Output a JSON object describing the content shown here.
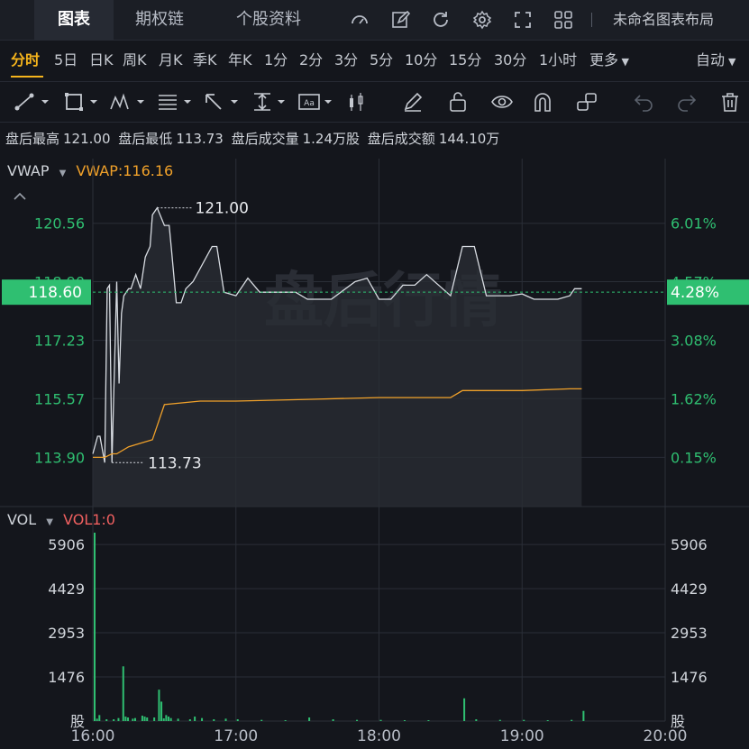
{
  "tabs": [
    {
      "label": "图表",
      "active": true
    },
    {
      "label": "期权链",
      "active": false
    },
    {
      "label": "个股资料",
      "active": false
    }
  ],
  "layout_label": "未命名图表布局",
  "toolbar_icons": [
    "gauge-icon",
    "edit-icon",
    "refresh-icon",
    "settings-icon",
    "fullscreen-icon",
    "grid-icon"
  ],
  "periods": [
    "分时",
    "5日",
    "日K",
    "周K",
    "月K",
    "季K",
    "年K",
    "1分",
    "2分",
    "3分",
    "5分",
    "10分",
    "15分",
    "30分",
    "1小时",
    "更多"
  ],
  "active_period": "分时",
  "auto_label": "自动",
  "drawing_tools": [
    "line-tool-icon",
    "rectangle-tool-icon",
    "pattern-tool-icon",
    "fib-tool-icon",
    "arrow-tool-icon",
    "measure-tool-icon",
    "text-tool-icon",
    "candle-tool-icon",
    "pen-icon",
    "unlock-icon",
    "eye-icon",
    "magnet-icon",
    "link-icon",
    "undo-icon",
    "redo-icon",
    "trash-icon"
  ],
  "info": {
    "high_label": "盘后最高",
    "high": "121.00",
    "low_label": "盘后最低",
    "low": "113.73",
    "vol_label": "盘后成交量",
    "vol": "1.24万股",
    "amt_label": "盘后成交额",
    "amt": "144.10万"
  },
  "main_indicator": {
    "name": "VWAP",
    "value_label": "VWAP:116.16"
  },
  "vol_indicator": {
    "name": "VOL",
    "value_label": "VOL1:0"
  },
  "watermark": "盘后行情",
  "current_price": "118.60",
  "current_pct": "4.28%",
  "high_marker": "121.00",
  "low_marker": "113.73",
  "colors": {
    "up": "#2fbf71",
    "down": "#f06060",
    "vwap": "#f0a12a",
    "accent": "#f5b41c",
    "bg": "#14161c"
  },
  "chart_data": [
    {
      "type": "line",
      "title": "",
      "x_ticks": [
        "16:00",
        "17:00",
        "18:00",
        "19:00",
        "20:00"
      ],
      "xlim": [
        "16:00",
        "20:00"
      ],
      "y_ticks": [
        "120.56",
        "118.90",
        "117.23",
        "115.57",
        "113.90"
      ],
      "y_ticks_right": [
        "6.01%",
        "4.57%",
        "3.08%",
        "1.62%",
        "0.15%"
      ],
      "ylim": [
        112.5,
        122.4
      ],
      "grid": true,
      "series": [
        {
          "name": "",
          "color": "#d8dce2",
          "x": [
            "16:00",
            "16:02",
            "16:03",
            "16:05",
            "16:06",
            "16:07",
            "16:08",
            "16:10",
            "16:11",
            "16:12",
            "16:13",
            "16:15",
            "16:16",
            "16:18",
            "16:20",
            "16:22",
            "16:24",
            "16:25",
            "16:27",
            "16:30",
            "16:32",
            "16:33",
            "16:35",
            "16:37",
            "16:39",
            "16:42",
            "16:50",
            "16:52",
            "16:55",
            "17:00",
            "17:05",
            "17:10",
            "17:12",
            "17:15",
            "17:20",
            "17:25",
            "17:30",
            "17:40",
            "17:50",
            "17:55",
            "18:00",
            "18:05",
            "18:10",
            "18:15",
            "18:20",
            "18:30",
            "18:35",
            "18:40",
            "18:45",
            "18:50",
            "18:55",
            "19:00",
            "19:05",
            "19:10",
            "19:15",
            "19:20",
            "19:22",
            "19:25"
          ],
          "values": [
            114.0,
            114.5,
            114.5,
            113.75,
            118.7,
            118.8,
            113.75,
            118.9,
            116.0,
            118.0,
            118.5,
            118.7,
            118.7,
            119.1,
            118.7,
            119.6,
            119.9,
            120.8,
            121.0,
            120.5,
            120.5,
            119.8,
            118.3,
            118.3,
            118.7,
            118.9,
            119.9,
            119.9,
            118.6,
            118.5,
            119.0,
            118.6,
            118.6,
            118.6,
            118.6,
            118.6,
            118.4,
            118.4,
            118.9,
            119.0,
            118.4,
            118.4,
            118.8,
            118.8,
            119.1,
            118.5,
            119.9,
            119.9,
            118.5,
            118.5,
            118.5,
            118.55,
            118.4,
            118.4,
            118.4,
            118.5,
            118.7,
            118.7
          ]
        },
        {
          "name": "VWAP",
          "color": "#f0a12a",
          "x": [
            "16:00",
            "16:05",
            "16:08",
            "16:10",
            "16:15",
            "16:20",
            "16:25",
            "16:30",
            "16:45",
            "17:00",
            "17:30",
            "18:00",
            "18:30",
            "18:35",
            "19:00",
            "19:20",
            "19:25"
          ],
          "values": [
            113.9,
            113.9,
            114.0,
            114.0,
            114.2,
            114.3,
            114.4,
            115.4,
            115.5,
            115.5,
            115.55,
            115.6,
            115.6,
            115.8,
            115.8,
            115.85,
            115.85
          ]
        }
      ]
    },
    {
      "type": "bar",
      "title": "",
      "x_ticks": [
        "16:00",
        "17:00",
        "18:00",
        "19:00",
        "20:00"
      ],
      "y_ticks": [
        "5906",
        "4429",
        "2953",
        "1476",
        "股"
      ],
      "ylim": [
        0,
        6300
      ],
      "color": "#2fbf71",
      "x": [
        "16:00",
        "16:01",
        "16:02",
        "16:05",
        "16:08",
        "16:10",
        "16:12",
        "16:13",
        "16:14",
        "16:16",
        "16:17",
        "16:20",
        "16:21",
        "16:22",
        "16:25",
        "16:27",
        "16:28",
        "16:29",
        "16:30",
        "16:31",
        "16:32",
        "16:35",
        "16:40",
        "16:42",
        "16:45",
        "16:50",
        "16:55",
        "17:00",
        "17:10",
        "17:20",
        "17:30",
        "17:40",
        "17:50",
        "18:00",
        "18:10",
        "18:20",
        "18:35",
        "18:40",
        "18:50",
        "19:00",
        "19:10",
        "19:20",
        "19:25"
      ],
      "values": [
        6300,
        80,
        200,
        60,
        60,
        100,
        1830,
        150,
        120,
        80,
        100,
        180,
        150,
        120,
        120,
        1050,
        650,
        90,
        200,
        150,
        100,
        80,
        60,
        150,
        100,
        60,
        80,
        60,
        40,
        30,
        120,
        60,
        40,
        40,
        30,
        30,
        760,
        60,
        40,
        40,
        30,
        40,
        340
      ]
    }
  ]
}
